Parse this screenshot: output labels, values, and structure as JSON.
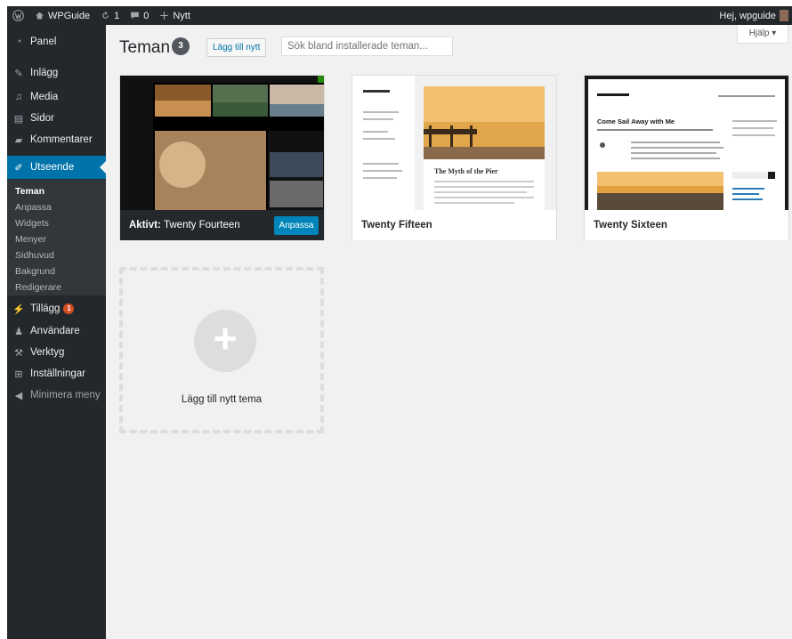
{
  "adminbar": {
    "site_name": "WPGuide",
    "updates_count": "1",
    "comments_count": "0",
    "new_label": "Nytt",
    "greeting": "Hej, wpguide"
  },
  "sidebar": {
    "items": [
      {
        "label": "Panel",
        "icon": "dashboard-icon"
      },
      {
        "label": "Inlägg",
        "icon": "pin-icon"
      },
      {
        "label": "Media",
        "icon": "media-icon"
      },
      {
        "label": "Sidor",
        "icon": "page-icon"
      },
      {
        "label": "Kommentarer",
        "icon": "comment-icon"
      },
      {
        "label": "Utseende",
        "icon": "brush-icon"
      },
      {
        "label": "Tillägg",
        "icon": "plugin-icon",
        "badge": "1"
      },
      {
        "label": "Användare",
        "icon": "users-icon"
      },
      {
        "label": "Verktyg",
        "icon": "wrench-icon"
      },
      {
        "label": "Inställningar",
        "icon": "settings-icon"
      },
      {
        "label": "Minimera meny",
        "icon": "collapse-icon"
      }
    ],
    "submenu": [
      "Teman",
      "Anpassa",
      "Widgets",
      "Menyer",
      "Sidhuvud",
      "Bakgrund",
      "Redigerare"
    ],
    "current_submenu": "Teman"
  },
  "header": {
    "title": "Teman",
    "count": "3",
    "add_new_label": "Lägg till nytt",
    "search_placeholder": "Sök bland installerade teman...",
    "help_label": "Hjälp ▾"
  },
  "themes": [
    {
      "name": "Twenty Fourteen",
      "active_prefix": "Aktivt:",
      "active": true,
      "customize_label": "Anpassa"
    },
    {
      "name": "Twenty Fifteen",
      "active": false,
      "preview_heading": "The Myth of the Pier"
    },
    {
      "name": "Twenty Sixteen",
      "active": false,
      "preview_heading": "Come Sail Away with Me"
    }
  ],
  "add_theme_label": "Lägg till nytt tema",
  "colors": {
    "admin_bg": "#23282d",
    "accent": "#0073aa",
    "button": "#0085ba",
    "content_bg": "#f1f1f1"
  }
}
